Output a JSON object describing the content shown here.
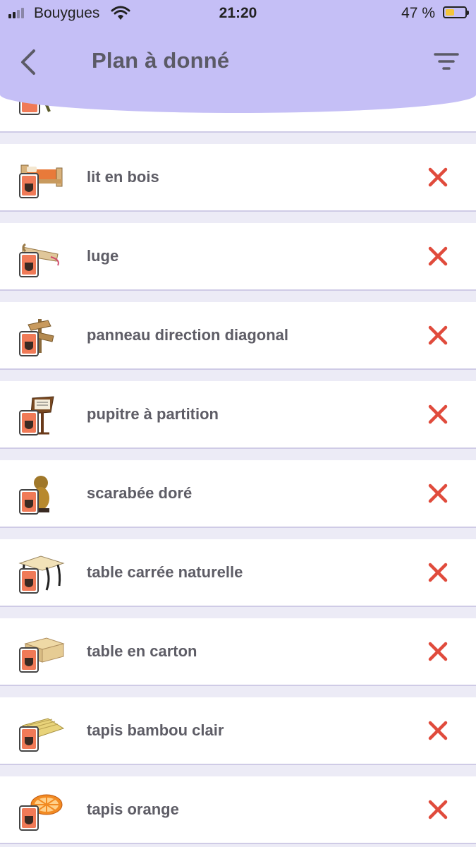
{
  "status_bar": {
    "carrier": "Bouygues",
    "time": "21:20",
    "battery_percent": "47 %"
  },
  "header": {
    "title": "Plan à donné",
    "back_icon": "chevron-left-icon",
    "filter_icon": "filter-icon"
  },
  "colors": {
    "header_bg": "#c5bff6",
    "list_bg": "#ecebf6",
    "remove_icon": "#e04b3c",
    "recipe_card": "#f07a57"
  },
  "items": [
    {
      "label": "",
      "icon": "recipe-card-icon"
    },
    {
      "label": "lit en bois",
      "icon": "wooden-bed-icon"
    },
    {
      "label": "luge",
      "icon": "sled-icon"
    },
    {
      "label": "panneau direction diagonal",
      "icon": "direction-sign-icon"
    },
    {
      "label": "pupitre à partition",
      "icon": "music-stand-icon"
    },
    {
      "label": "scarabée doré",
      "icon": "golden-beetle-icon"
    },
    {
      "label": "table carrée naturelle",
      "icon": "square-table-icon"
    },
    {
      "label": "table en carton",
      "icon": "cardboard-table-icon"
    },
    {
      "label": "tapis bambou clair",
      "icon": "bamboo-rug-icon"
    },
    {
      "label": "tapis orange",
      "icon": "orange-rug-icon"
    }
  ]
}
